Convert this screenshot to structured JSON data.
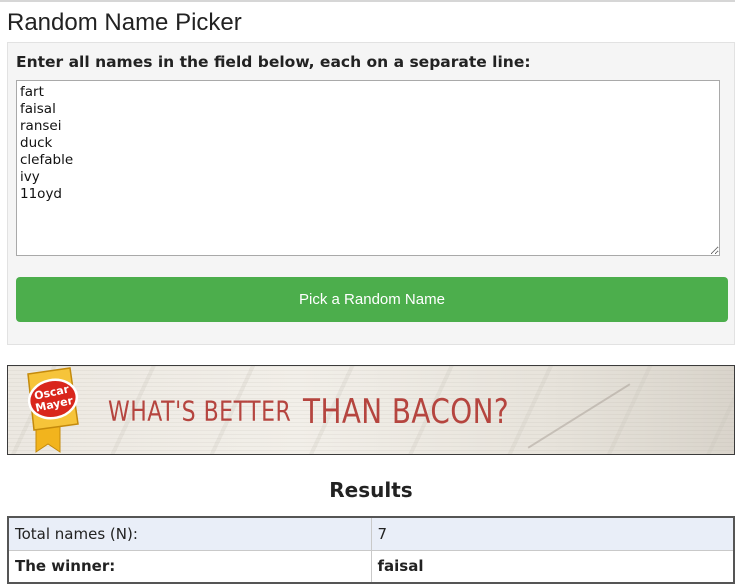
{
  "page": {
    "title": "Random Name Picker"
  },
  "form": {
    "prompt": "Enter all names in the field below, each on a separate line:",
    "names": [
      "fart",
      "faisal",
      "ransei",
      "duck",
      "clefable",
      "ivy",
      "11oyd"
    ],
    "button_label": "Pick a Random Name",
    "button_color": "#4cae4c"
  },
  "ad": {
    "brand_line1": "Oscar",
    "brand_line2": "Mayer",
    "headline_small": "WHAT'S BETTER",
    "headline_big": "THAN BACON?",
    "headline_color": "#b5453f"
  },
  "results": {
    "heading": "Results",
    "rows": [
      {
        "label": "Total names (N):",
        "value": "7"
      },
      {
        "label": "The winner:",
        "value": "faisal"
      }
    ],
    "row_highlight_color": "#e9eef8"
  }
}
